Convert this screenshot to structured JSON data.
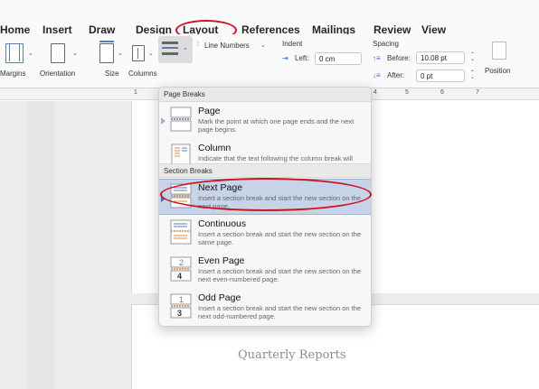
{
  "tabs": [
    "Home",
    "Insert",
    "Draw",
    "Design",
    "Layout",
    "References",
    "Mailings",
    "Review",
    "View"
  ],
  "ribbon": {
    "buttons": [
      "Margins",
      "Orientation",
      "Size",
      "Columns"
    ],
    "line_numbers": "Line Numbers",
    "indent": {
      "title": "Indent",
      "left_label": "Left:",
      "left_value": "0 cm"
    },
    "spacing": {
      "title": "Spacing",
      "before_label": "Before:",
      "before_value": "10.08 pt",
      "after_label": "After:",
      "after_value": "0 pt"
    },
    "position": "Position"
  },
  "ruler": [
    "1",
    "4",
    "5",
    "6",
    "7"
  ],
  "menu": {
    "page_breaks_header": "Page Breaks",
    "section_breaks_header": "Section Breaks",
    "items": [
      {
        "title": "Page",
        "desc": "Mark the point at which one page ends and the next page begins."
      },
      {
        "title": "Column",
        "desc": "Indicate that the text following the column break will begin in the next column."
      },
      {
        "title": "Next Page",
        "desc": "Insert a section break and start the new section on the next page."
      },
      {
        "title": "Continuous",
        "desc": "Insert a section break and start the new section on the same page."
      },
      {
        "title": "Even Page",
        "desc": "Insert a section break and start the new section on the next even-numbered page."
      },
      {
        "title": "Odd Page",
        "desc": "Insert a section break and start the new section on the next odd-numbered page."
      }
    ],
    "icon_digits": {
      "even_top": "2",
      "even_bottom": "4",
      "odd_top": "1",
      "odd_bottom": "3"
    }
  },
  "document": {
    "title": "Quarterly Reports"
  },
  "colors": {
    "annotation_red": "#d0121b",
    "selection_blue": "#c6d3e8",
    "icon_blue": "#5a7fb6",
    "icon_orange": "#e0883a"
  }
}
